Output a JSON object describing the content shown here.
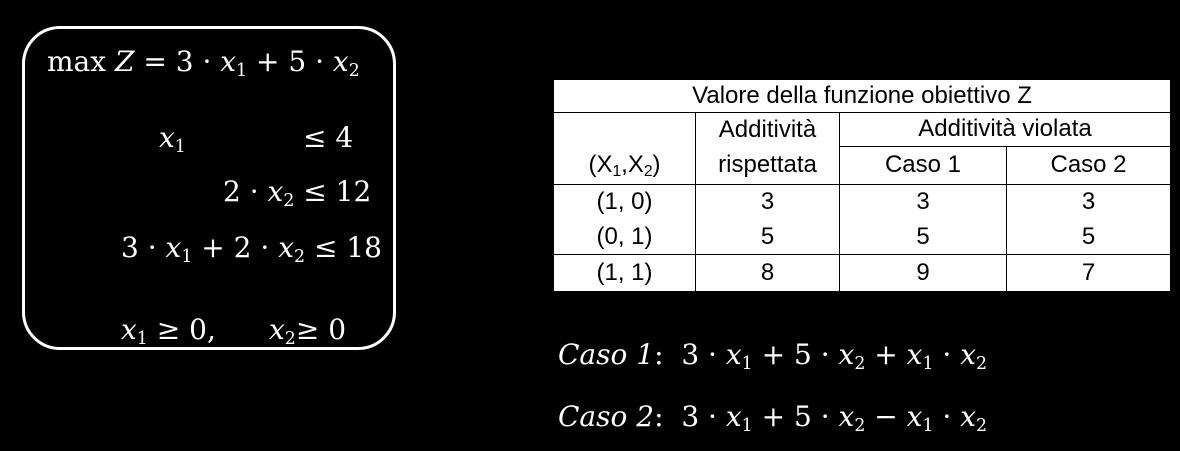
{
  "model": {
    "max": "max",
    "objective_var": "Z",
    "eq": "=",
    "c_x1": "3",
    "c_x2": "5",
    "dot": "·",
    "plus": "+",
    "x": "x",
    "sub1": "1",
    "sub2": "2",
    "le": "≤",
    "ge": "≥",
    "c1_rhs": "4",
    "c2_coef": "2",
    "c2_rhs": "12",
    "c3_coef1": "3",
    "c3_coef2": "2",
    "c3_rhs": "18",
    "zero": "0",
    "comma": ","
  },
  "table": {
    "title": "Valore della funzione obiettivo Z",
    "col_pair_X": "X",
    "col_pair_open": "(",
    "col_pair_sep": ",",
    "col_pair_close": ")",
    "col_sub1": "1",
    "col_sub2": "2",
    "additivity_kept_1": "Additività",
    "additivity_kept_2": "rispettata",
    "additivity_violated": "Additività violata",
    "case1": "Caso 1",
    "case2": "Caso 2",
    "rows": [
      {
        "point": "(1, 0)",
        "kept": "3",
        "case1": "3",
        "case2": "3"
      },
      {
        "point": "(0, 1)",
        "kept": "5",
        "case1": "5",
        "case2": "5"
      },
      {
        "point": "(1, 1)",
        "kept": "8",
        "case1": "9",
        "case2": "7"
      }
    ]
  },
  "formulas": {
    "case1_label": "Caso 1",
    "case2_label": "Caso 2",
    "colon": ":",
    "minus": "−"
  }
}
